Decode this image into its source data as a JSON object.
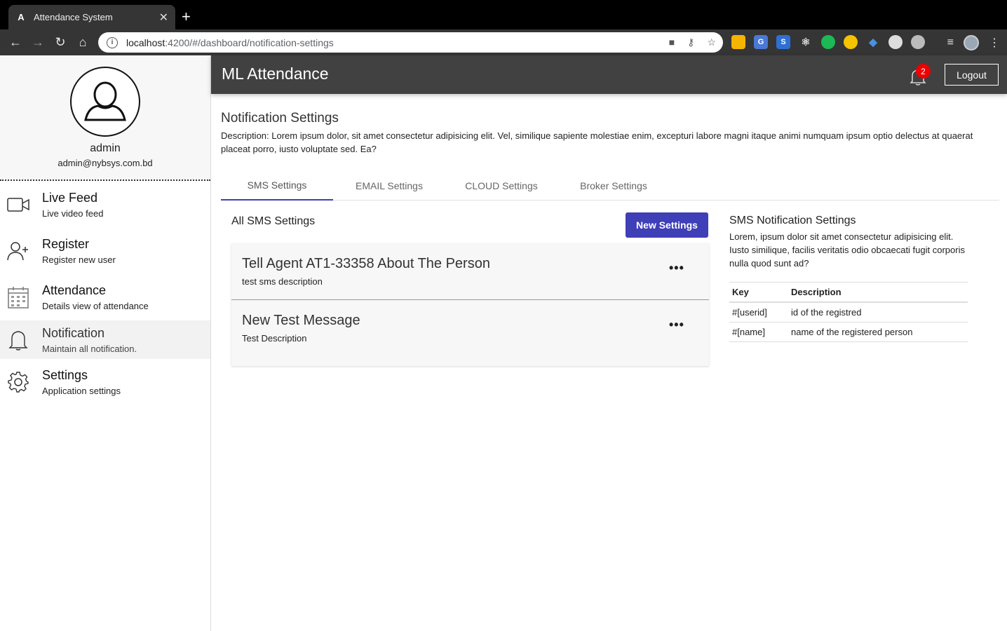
{
  "browser": {
    "tab_title": "Attendance System",
    "tab_favicon": "A",
    "url_host": "localhost",
    "url_rest": ":4200/#/dashboard/notification-settings"
  },
  "sidebar": {
    "username": "admin",
    "email": "admin@nybsys.com.bd",
    "items": [
      {
        "title": "Live Feed",
        "subtitle": "Live video feed",
        "icon": "video-camera-icon"
      },
      {
        "title": "Register",
        "subtitle": "Register new user",
        "icon": "add-user-icon"
      },
      {
        "title": "Attendance",
        "subtitle": "Details view of attendance",
        "icon": "calendar-icon"
      },
      {
        "title": "Notification",
        "subtitle": "Maintain all notification.",
        "icon": "bell-icon"
      },
      {
        "title": "Settings",
        "subtitle": "Application settings",
        "icon": "gear-icon"
      }
    ]
  },
  "header": {
    "title": "ML Attendance",
    "badge_count": "2",
    "logout_label": "Logout"
  },
  "main": {
    "page_title": "Notification Settings",
    "page_description": "Description: Lorem ipsum dolor, sit amet consectetur adipisicing elit. Vel, similique sapiente molestiae enim, excepturi labore magni itaque animi numquam ipsum optio delectus at quaerat placeat porro, iusto voluptate sed. Ea?",
    "tabs": [
      "SMS Settings",
      "EMAIL Settings",
      "CLOUD Settings",
      "Broker Settings"
    ],
    "list_title": "All SMS Settings",
    "new_button_label": "New Settings",
    "cards": [
      {
        "title": "Tell Agent AT1-33358 About The Person",
        "description": "test sms description"
      },
      {
        "title": "New Test Message",
        "description": "Test Description"
      }
    ],
    "info": {
      "title": "SMS Notification Settings",
      "description": "Lorem, ipsum dolor sit amet consectetur adipisicing elit. Iusto similique, facilis veritatis odio obcaecati fugit corporis nulla quod sunt ad?",
      "table_headers": [
        "Key",
        "Description"
      ],
      "rows": [
        [
          "#[userid]",
          "id of the registred"
        ],
        [
          "#[name]",
          "name of the registered person"
        ]
      ]
    }
  },
  "colors": {
    "accent": "#3f3fb8",
    "header_bg": "#414141",
    "badge": "#e00000"
  }
}
